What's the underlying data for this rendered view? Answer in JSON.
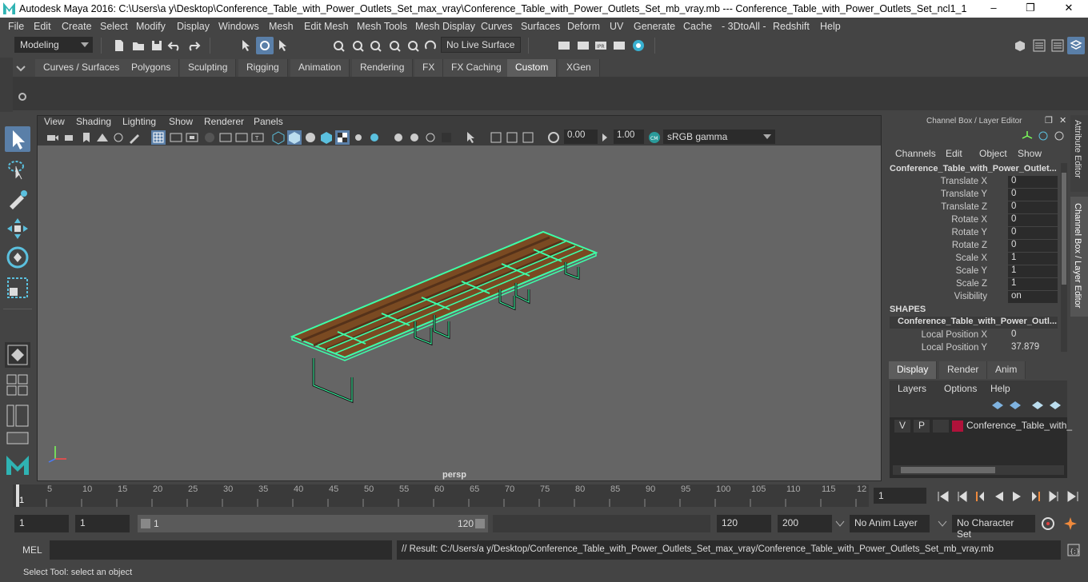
{
  "window": {
    "title": "Autodesk Maya 2016: C:\\Users\\a y\\Desktop\\Conference_Table_with_Power_Outlets_Set_max_vray\\Conference_Table_with_Power_Outlets_Set_mb_vray.mb   ---   Conference_Table_with_Power_Outlets_Set_ncl1_1",
    "minimize": "–",
    "maximize": "❐",
    "close": "✕"
  },
  "menubar": [
    "File",
    "Edit",
    "Create",
    "Select",
    "Modify",
    "Display",
    "Windows",
    "Mesh",
    "Edit Mesh",
    "Mesh Tools",
    "Mesh Display",
    "Curves",
    "Surfaces",
    "Deform",
    "UV",
    "Generate",
    "Cache",
    "- 3DtoAll -",
    "Redshift",
    "Help"
  ],
  "statusline": {
    "mode": "Modeling",
    "live_surface": "No Live Surface"
  },
  "shelf": {
    "tabs": [
      "Curves / Surfaces",
      "Polygons",
      "Sculpting",
      "Rigging",
      "Animation",
      "Rendering",
      "FX",
      "FX Caching",
      "Custom",
      "XGen"
    ],
    "active": "Custom"
  },
  "viewport": {
    "menu": [
      "View",
      "Shading",
      "Lighting",
      "Show",
      "Renderer",
      "Panels"
    ],
    "exposure": "0.00",
    "gamma": "1.00",
    "color_space": "sRGB gamma",
    "camera_label": "persp"
  },
  "channelbox": {
    "header": "Channel Box / Layer Editor",
    "menu": [
      "Channels",
      "Edit",
      "Object",
      "Show"
    ],
    "object_name": "Conference_Table_with_Power_Outlet...",
    "channels": [
      {
        "label": "Translate X",
        "value": "0"
      },
      {
        "label": "Translate Y",
        "value": "0"
      },
      {
        "label": "Translate Z",
        "value": "0"
      },
      {
        "label": "Rotate X",
        "value": "0"
      },
      {
        "label": "Rotate Y",
        "value": "0"
      },
      {
        "label": "Rotate Z",
        "value": "0"
      },
      {
        "label": "Scale X",
        "value": "1"
      },
      {
        "label": "Scale Y",
        "value": "1"
      },
      {
        "label": "Scale Z",
        "value": "1"
      },
      {
        "label": "Visibility",
        "value": "on"
      }
    ],
    "shapes_heading": "SHAPES",
    "shape_name": "Conference_Table_with_Power_Outl...",
    "shape_channels": [
      {
        "label": "Local Position X",
        "value": "0"
      },
      {
        "label": "Local Position Y",
        "value": "37.879"
      }
    ],
    "side_tabs": [
      "Attribute Editor",
      "Channel Box / Layer Editor"
    ]
  },
  "layereditor": {
    "tabs": [
      "Display",
      "Render",
      "Anim"
    ],
    "active_tab": "Display",
    "menu": [
      "Layers",
      "Options",
      "Help"
    ],
    "layer": {
      "v": "V",
      "p": "P",
      "name": "Conference_Table_with_",
      "color": "#b0123a"
    }
  },
  "timeline": {
    "ticks": [
      "5",
      "10",
      "15",
      "20",
      "25",
      "30",
      "35",
      "40",
      "45",
      "50",
      "55",
      "60",
      "65",
      "70",
      "75",
      "80",
      "85",
      "90",
      "95",
      "100",
      "105",
      "110",
      "115",
      "12"
    ],
    "start_label": "1",
    "current_frame": "1"
  },
  "range": {
    "start": "1",
    "playback_start": "1",
    "slider_start": "1",
    "slider_end": "120",
    "playback_end": "120",
    "end": "200",
    "anim_layer": "No Anim Layer",
    "character_set": "No Character Set"
  },
  "commandline": {
    "label": "MEL",
    "result": "// Result: C:/Users/a y/Desktop/Conference_Table_with_Power_Outlets_Set_max_vray/Conference_Table_with_Power_Outlets_Set_mb_vray.mb"
  },
  "helpline": "Select Tool: select an object",
  "colors": {
    "wire": "#3dffa8",
    "wood": "#7a4a22",
    "accent": "#5a7fa8"
  }
}
